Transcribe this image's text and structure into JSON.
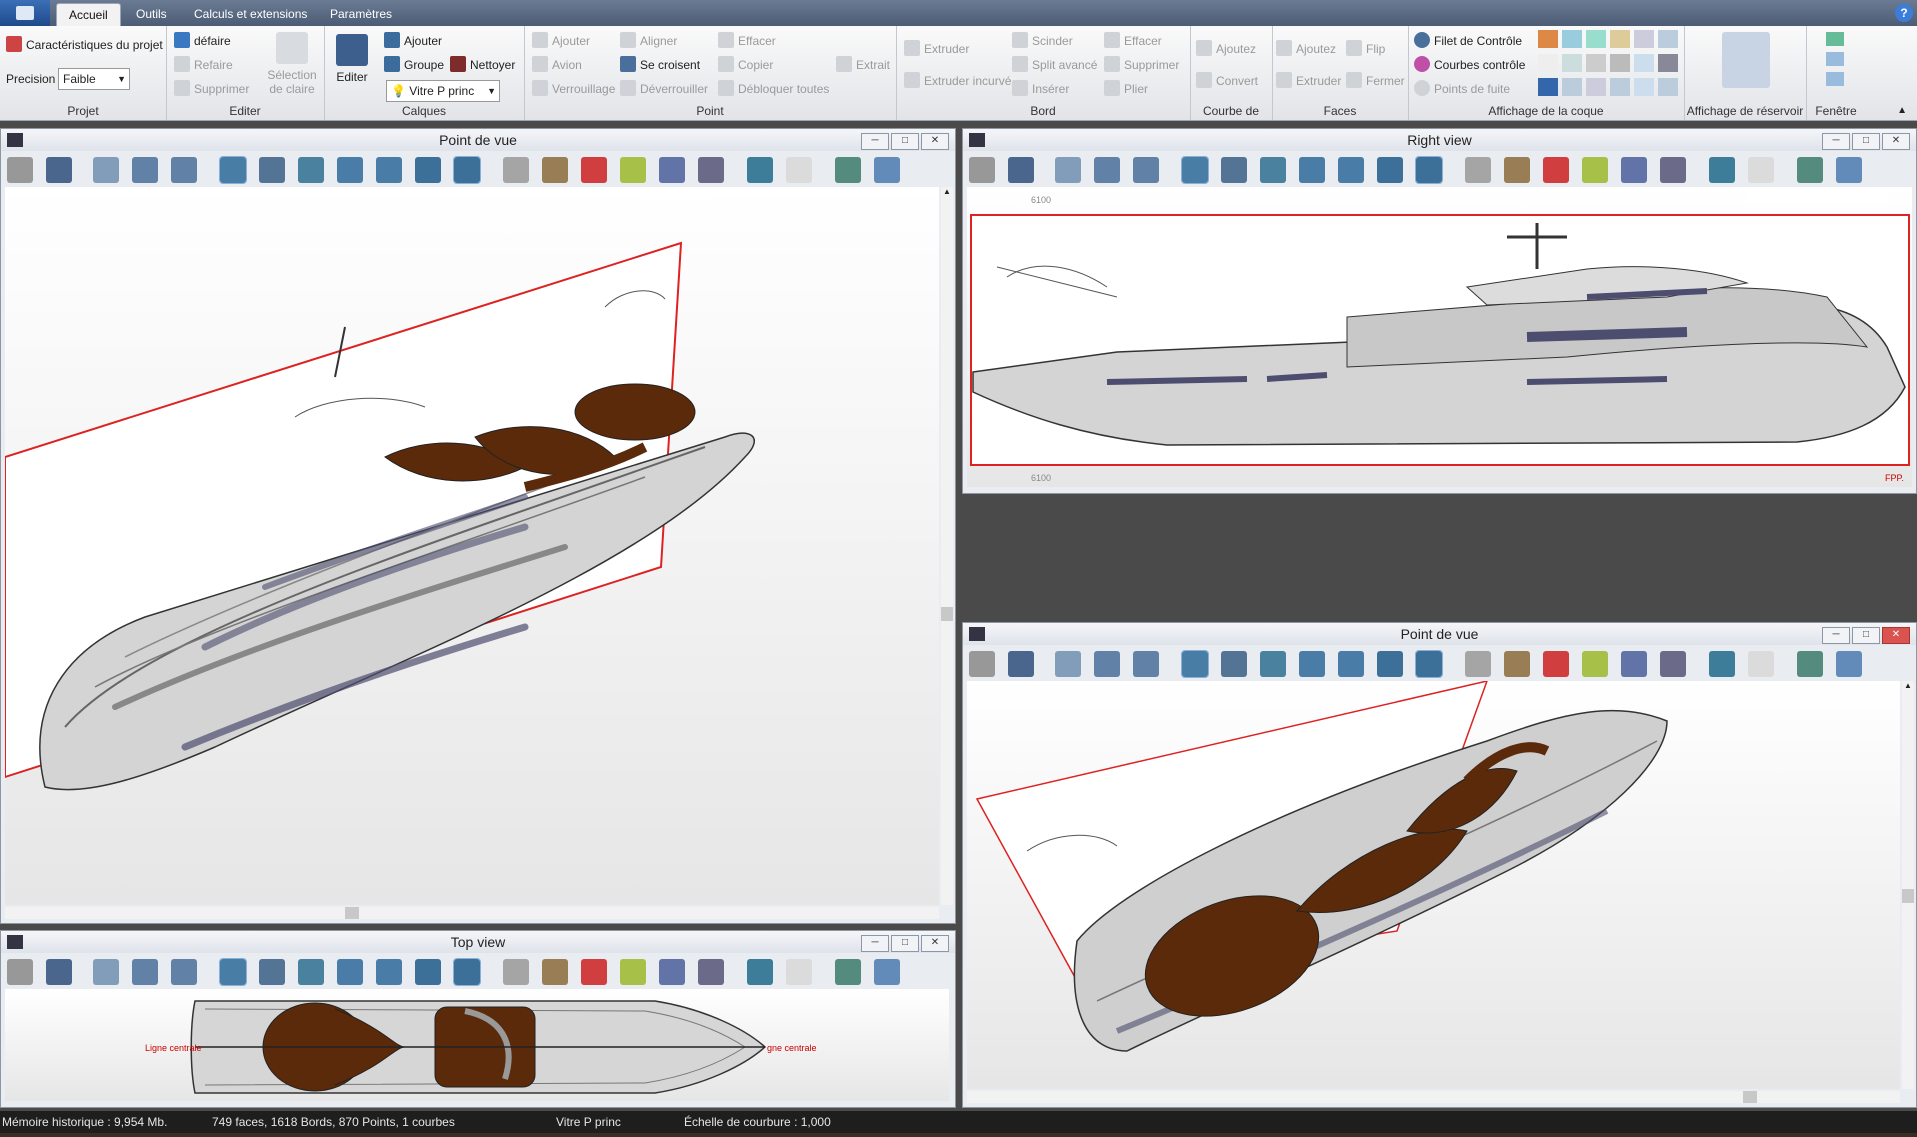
{
  "tabs": {
    "t0": "Accueil",
    "t1": "Outils",
    "t2": "Calculs et extensions",
    "t3": "Paramètres"
  },
  "projet": {
    "title": "Projet",
    "caracteristiques": "Caractéristiques du projet",
    "precision_label": "Precision",
    "precision_value": "Faible"
  },
  "editer": {
    "title": "Editer",
    "defaire": "défaire",
    "refaire": "Refaire",
    "supprimer": "Supprimer",
    "selection": "Sélection de claire"
  },
  "calques": {
    "title": "Calques",
    "editer": "Editer",
    "ajouter": "Ajouter",
    "groupe": "Groupe",
    "nettoyer": "Nettoyer",
    "layer": "Vitre P princ"
  },
  "point": {
    "title": "Point",
    "ajouter": "Ajouter",
    "avion": "Avion",
    "verrouillage": "Verrouillage",
    "aligner": "Aligner",
    "se_croisent": "Se croisent",
    "deverrouiller": "Déverrouiller",
    "effacer": "Effacer",
    "copier": "Copier",
    "debloquer": "Débloquer toutes",
    "extrait": "Extrait"
  },
  "bord": {
    "title": "Bord",
    "extruder": "Extruder",
    "extruder_incurve": "Extruder incurvé",
    "scinder": "Scinder",
    "split": "Split avancé",
    "inserer": "Insérer",
    "effacer": "Effacer",
    "supprimer": "Supprimer",
    "plier": "Plier"
  },
  "courbe": {
    "title": "Courbe de",
    "ajoutez": "Ajoutez",
    "convert": "Convert"
  },
  "faces": {
    "title": "Faces",
    "ajoutez": "Ajoutez",
    "flip": "Flip",
    "extruder": "Extruder",
    "fermer": "Fermer"
  },
  "coque": {
    "title": "Affichage de la coque",
    "filet": "Filet de Contrôle",
    "courbes": "Courbes  contrôle",
    "points": "Points de fuite"
  },
  "reservoir": {
    "title": "Affichage de réservoir"
  },
  "fenetre": {
    "title": "Fenêtre"
  },
  "windows": {
    "w1": "Point de vue",
    "w2": "Right view",
    "w3": "Top view",
    "w4": "Point de vue"
  },
  "right_view": {
    "label_top": "6100",
    "label_bottom": "6100",
    "fpp": "FPP."
  },
  "top_view": {
    "centre_left": "Ligne centrale",
    "centre_right": "gne centrale"
  },
  "status": {
    "memoire": "Mémoire historique : 9,954 Mb.",
    "counts": "749 faces, 1618 Bords, 870 Points, 1 courbes",
    "layer": "Vitre P princ",
    "echelle": "Échelle de courbure : 1,000"
  }
}
